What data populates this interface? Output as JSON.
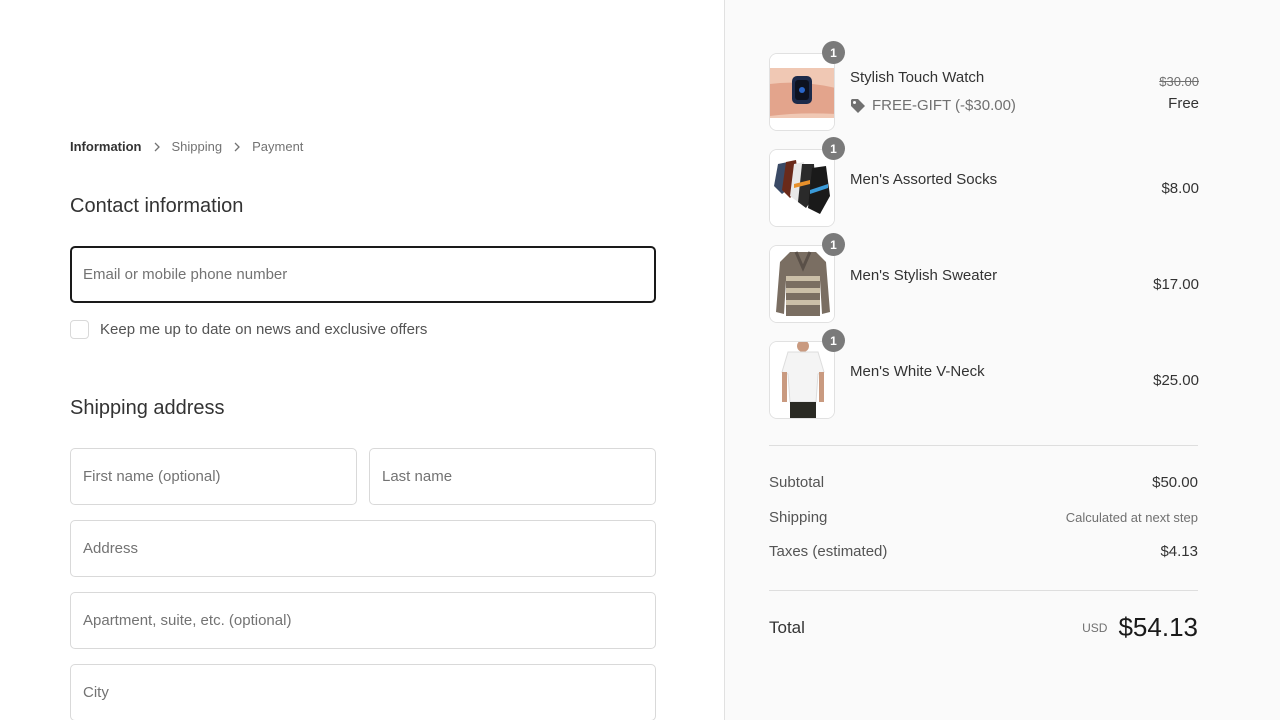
{
  "breadcrumb": {
    "items": [
      {
        "label": "Information",
        "active": true
      },
      {
        "label": "Shipping",
        "active": false
      },
      {
        "label": "Payment",
        "active": false
      }
    ]
  },
  "contact": {
    "title": "Contact information",
    "email_placeholder": "Email or mobile phone number",
    "email_value": "",
    "newsletter_label": "Keep me up to date on news and exclusive offers",
    "newsletter_checked": false
  },
  "shipping": {
    "title": "Shipping address",
    "first_name_placeholder": "First name (optional)",
    "last_name_placeholder": "Last name",
    "address_placeholder": "Address",
    "apartment_placeholder": "Apartment, suite, etc. (optional)",
    "city_placeholder": "City"
  },
  "cart": {
    "items": [
      {
        "name": "Stylish Touch Watch",
        "quantity": "1",
        "original_price": "$30.00",
        "price": "Free",
        "discount_code": "FREE-GIFT (-$30.00)",
        "image": "watch"
      },
      {
        "name": "Men's Assorted Socks",
        "quantity": "1",
        "price": "$8.00",
        "image": "socks"
      },
      {
        "name": "Men's Stylish Sweater",
        "quantity": "1",
        "price": "$17.00",
        "image": "sweater"
      },
      {
        "name": "Men's White V-Neck",
        "quantity": "1",
        "price": "$25.00",
        "image": "tshirt"
      }
    ]
  },
  "summary": {
    "subtotal_label": "Subtotal",
    "subtotal_value": "$50.00",
    "shipping_label": "Shipping",
    "shipping_value": "Calculated at next step",
    "taxes_label": "Taxes (estimated)",
    "taxes_value": "$4.13",
    "total_label": "Total",
    "currency": "USD",
    "total_value": "$54.13"
  },
  "colors": {
    "summary_background": "#fafafa",
    "focused_border": "#1a1a1a",
    "quantity_badge": "#7a7a7a"
  }
}
